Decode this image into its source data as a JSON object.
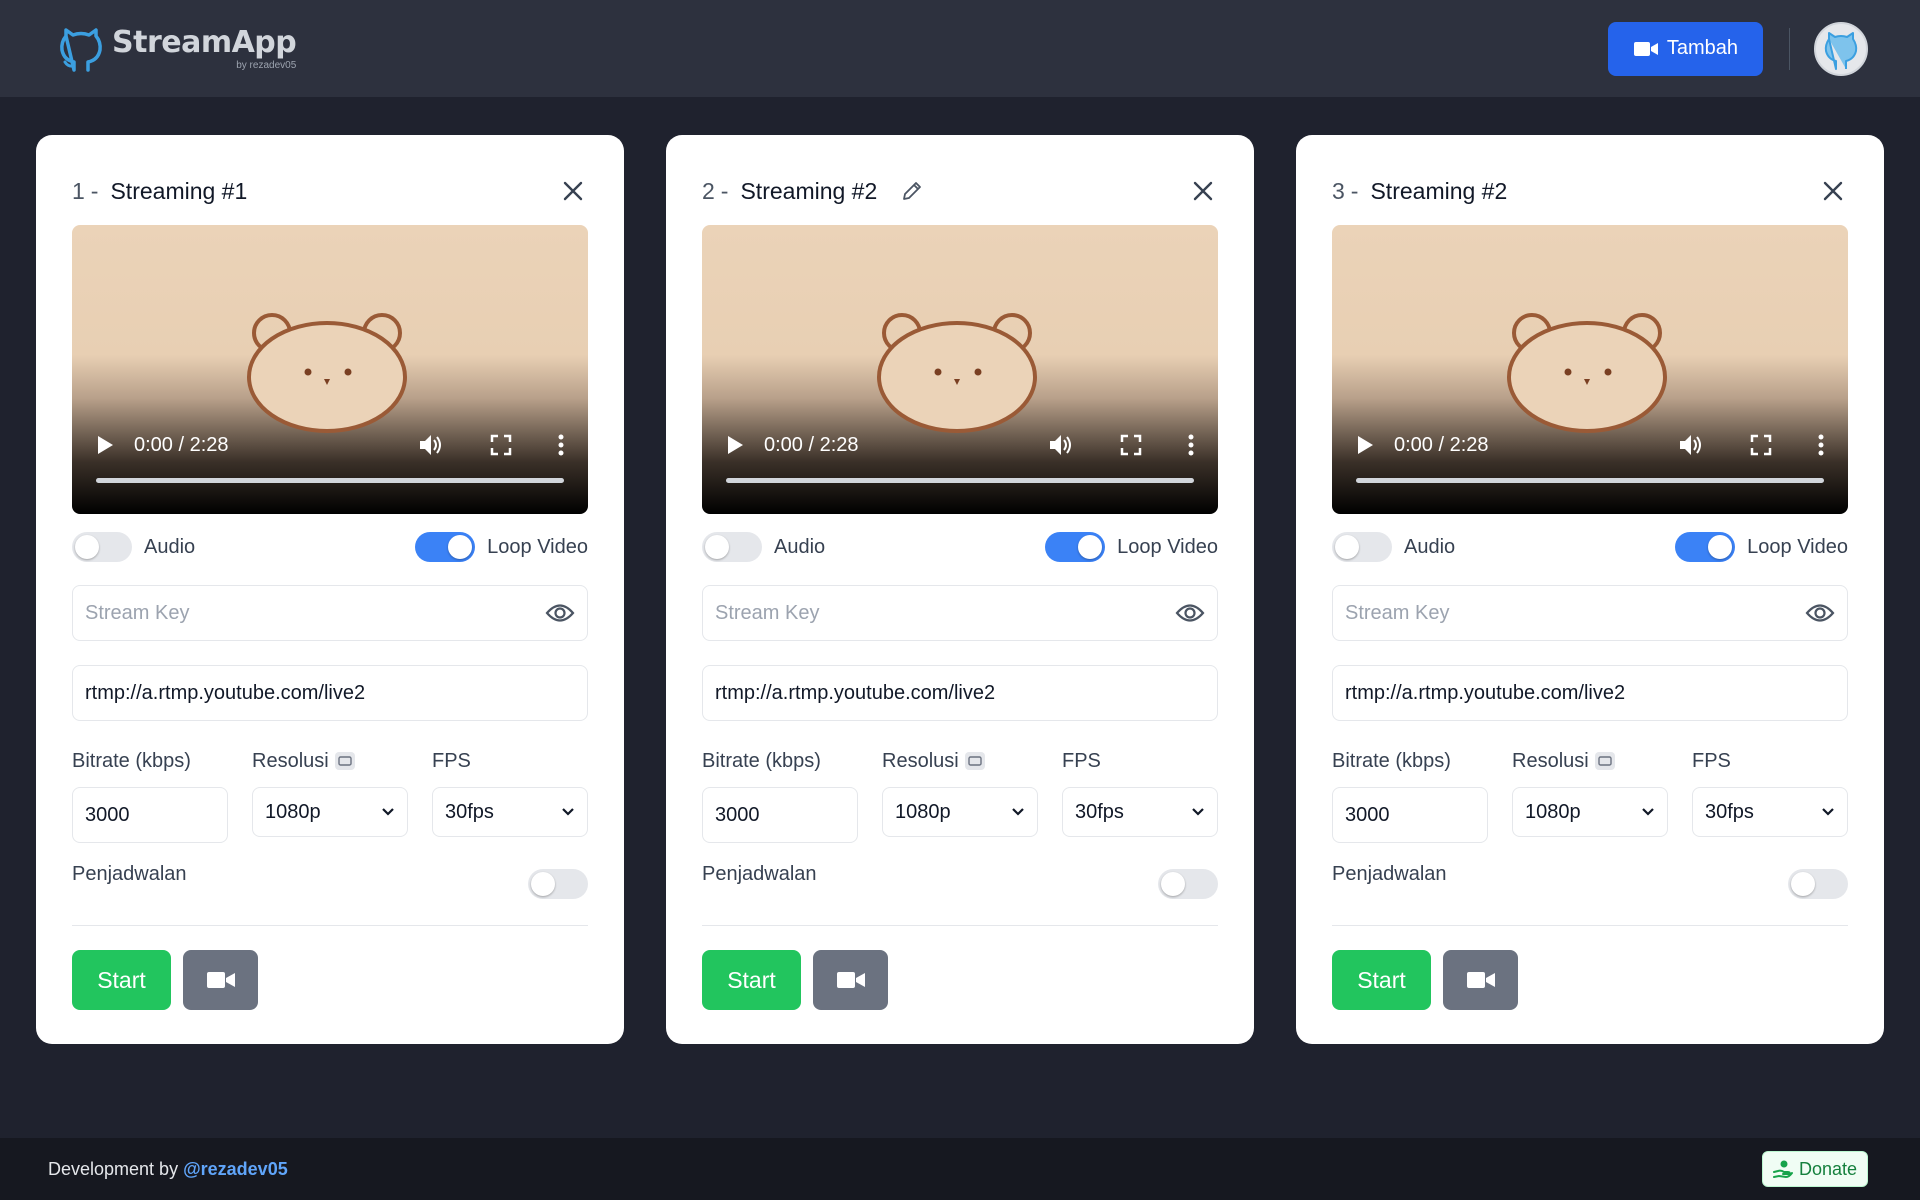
{
  "app": {
    "name": "StreamApp",
    "by": "by rezadev05",
    "add_button_label": "Tambah"
  },
  "colors": {
    "accent": "#2563eb",
    "start": "#22c55e",
    "toggle_on": "#3b82f6"
  },
  "cards": [
    {
      "number": "1",
      "separator": "-",
      "title": "Streaming #1",
      "video_time": "0:00 / 2:28",
      "audio_label": "Audio",
      "audio_on": false,
      "loop_label": "Loop Video",
      "loop_on": true,
      "stream_key_placeholder": "Stream Key",
      "stream_key_value": "",
      "rtmp_url": "rtmp://a.rtmp.youtube.com/live2",
      "bitrate_label": "Bitrate (kbps)",
      "bitrate_value": "3000",
      "resolution_label": "Resolusi",
      "resolution_value": "1080p",
      "fps_label": "FPS",
      "fps_value": "30fps",
      "schedule_label": "Penjadwalan",
      "schedule_on": false,
      "start_label": "Start"
    },
    {
      "number": "2",
      "separator": "-",
      "title": "Streaming #2",
      "video_time": "0:00 / 2:28",
      "audio_label": "Audio",
      "audio_on": false,
      "loop_label": "Loop Video",
      "loop_on": true,
      "stream_key_placeholder": "Stream Key",
      "stream_key_value": "",
      "rtmp_url": "rtmp://a.rtmp.youtube.com/live2",
      "bitrate_label": "Bitrate (kbps)",
      "bitrate_value": "3000",
      "resolution_label": "Resolusi",
      "resolution_value": "1080p",
      "fps_label": "FPS",
      "fps_value": "30fps",
      "schedule_label": "Penjadwalan",
      "schedule_on": false,
      "start_label": "Start"
    },
    {
      "number": "3",
      "separator": "-",
      "title": "Streaming #2",
      "video_time": "0:00 / 2:28",
      "audio_label": "Audio",
      "audio_on": false,
      "loop_label": "Loop Video",
      "loop_on": true,
      "stream_key_placeholder": "Stream Key",
      "stream_key_value": "",
      "rtmp_url": "rtmp://a.rtmp.youtube.com/live2",
      "bitrate_label": "Bitrate (kbps)",
      "bitrate_value": "3000",
      "resolution_label": "Resolusi",
      "resolution_value": "1080p",
      "fps_label": "FPS",
      "fps_value": "30fps",
      "schedule_label": "Penjadwalan",
      "schedule_on": false,
      "start_label": "Start"
    }
  ],
  "footer": {
    "text": "Development by",
    "link": "@rezadev05",
    "donate_label": "Donate"
  }
}
